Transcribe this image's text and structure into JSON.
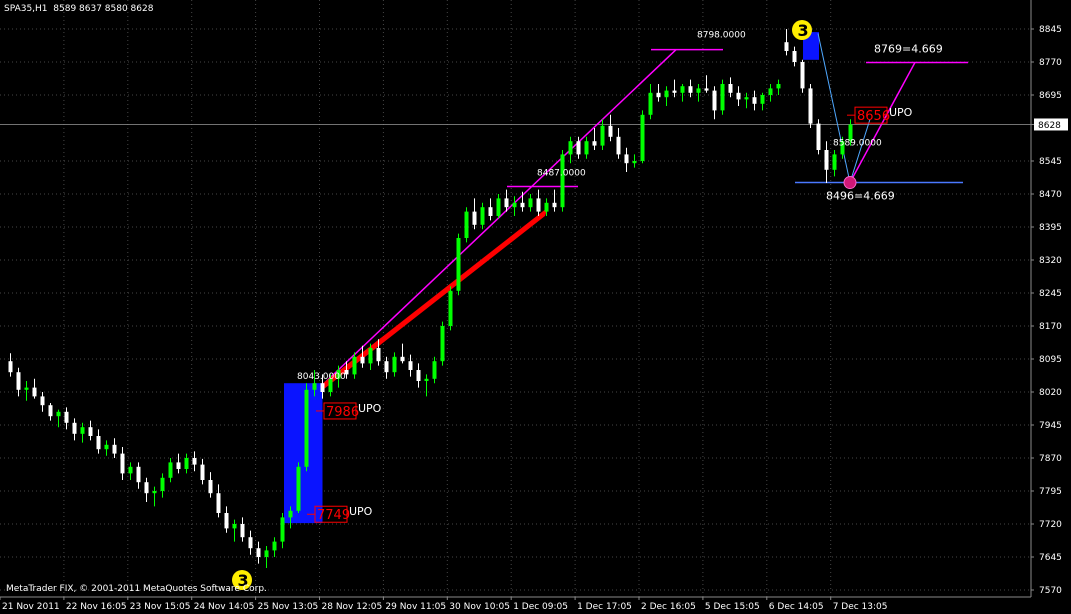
{
  "header": {
    "symbol": "SPA35,H1",
    "ohlc": "8589 8637 8580 8628"
  },
  "footer": {
    "copyright": "MetaTrader FIX, © 2001-2011 MetaQuotes Software Corp."
  },
  "colors": {
    "background": "#000000",
    "grid": "#464646",
    "bull": "#00ff00",
    "bear": "#ffffff",
    "trend_magenta": "#ff00ff",
    "trend_red": "#ff0000",
    "blue_box": "#0a14ff",
    "support_blue": "#4a78ff",
    "badge_yellow": "#ffee00",
    "label_red": "#ff0000"
  },
  "chart_data": {
    "type": "candlestick",
    "title": "SPA35,H1",
    "ylim": [
      7580,
      8880
    ],
    "y_ticks": [
      8845,
      8770,
      8695,
      8628,
      8545,
      8470,
      8395,
      8320,
      8245,
      8170,
      8095,
      8020,
      7945,
      7870,
      7795,
      7720,
      7645,
      7570
    ],
    "current_price": 8628,
    "x_ticks": [
      "21 Nov 2011",
      "22 Nov 16:05",
      "23 Nov 15:05",
      "24 Nov 14:05",
      "25 Nov 13:05",
      "28 Nov 12:05",
      "29 Nov 11:05",
      "30 Nov 10:05",
      "1 Dec 09:05",
      "1 Dec 17:05",
      "2 Dec 16:05",
      "5 Dec 15:05",
      "6 Dec 14:05",
      "7 Dec 13:05"
    ],
    "annotations": [
      {
        "text": "8043.0000",
        "price": 8043
      },
      {
        "text": "8487.0000",
        "price": 8487
      },
      {
        "text": "8798.0000",
        "price": 8798
      },
      {
        "text": "8769=4.669",
        "price": 8769
      },
      {
        "text": "8496=4.669",
        "price": 8496
      },
      {
        "text": "8589.0000",
        "price": 8589
      },
      {
        "text": "7986",
        "tag": "UPO",
        "price": 7986
      },
      {
        "text": "7749",
        "tag": "UPO",
        "price": 7749
      },
      {
        "text": "8656",
        "tag": "UPO",
        "price": 8656
      },
      {
        "text": "3",
        "kind": "badge",
        "price": 7610
      },
      {
        "text": "3",
        "kind": "badge",
        "price": 8850
      }
    ],
    "series": [
      {
        "values": [
          [
            8090,
            8108,
            8055,
            8065
          ],
          [
            8065,
            8075,
            8010,
            8025
          ],
          [
            8025,
            8045,
            8000,
            8030
          ],
          [
            8030,
            8050,
            8005,
            8010
          ],
          [
            8010,
            8020,
            7975,
            7990
          ],
          [
            7990,
            7995,
            7955,
            7965
          ],
          [
            7965,
            7980,
            7940,
            7975
          ],
          [
            7975,
            7985,
            7935,
            7950
          ],
          [
            7950,
            7960,
            7910,
            7925
          ],
          [
            7925,
            7950,
            7905,
            7940
          ],
          [
            7940,
            7955,
            7910,
            7920
          ],
          [
            7920,
            7935,
            7880,
            7890
          ],
          [
            7890,
            7910,
            7875,
            7900
          ],
          [
            7900,
            7915,
            7870,
            7880
          ],
          [
            7880,
            7895,
            7820,
            7835
          ],
          [
            7835,
            7860,
            7820,
            7850
          ],
          [
            7850,
            7860,
            7800,
            7815
          ],
          [
            7815,
            7825,
            7770,
            7790
          ],
          [
            7790,
            7805,
            7760,
            7795
          ],
          [
            7795,
            7835,
            7780,
            7825
          ],
          [
            7825,
            7870,
            7815,
            7860
          ],
          [
            7860,
            7880,
            7835,
            7845
          ],
          [
            7845,
            7880,
            7835,
            7870
          ],
          [
            7870,
            7885,
            7840,
            7855
          ],
          [
            7855,
            7868,
            7810,
            7820
          ],
          [
            7820,
            7838,
            7780,
            7790
          ],
          [
            7790,
            7810,
            7735,
            7745
          ],
          [
            7745,
            7760,
            7700,
            7710
          ],
          [
            7710,
            7730,
            7680,
            7720
          ],
          [
            7720,
            7735,
            7680,
            7690
          ],
          [
            7690,
            7705,
            7650,
            7665
          ],
          [
            7665,
            7680,
            7630,
            7645
          ],
          [
            7645,
            7670,
            7620,
            7660
          ],
          [
            7660,
            7690,
            7645,
            7680
          ],
          [
            7680,
            7745,
            7665,
            7735
          ],
          [
            7735,
            7760,
            7710,
            7750
          ],
          [
            7750,
            7860,
            7745,
            7850
          ],
          [
            7850,
            8040,
            7840,
            8025
          ],
          [
            8025,
            8070,
            8010,
            8040
          ],
          [
            8040,
            8060,
            8005,
            8020
          ],
          [
            8020,
            8060,
            8010,
            8050
          ],
          [
            8050,
            8080,
            8030,
            8070
          ],
          [
            8070,
            8090,
            8050,
            8060
          ],
          [
            8060,
            8110,
            8050,
            8100
          ],
          [
            8100,
            8125,
            8075,
            8085
          ],
          [
            8085,
            8130,
            8070,
            8120
          ],
          [
            8120,
            8140,
            8080,
            8090
          ],
          [
            8090,
            8100,
            8050,
            8065
          ],
          [
            8065,
            8110,
            8055,
            8100
          ],
          [
            8100,
            8130,
            8085,
            8090
          ],
          [
            8090,
            8105,
            8055,
            8070
          ],
          [
            8070,
            8085,
            8030,
            8045
          ],
          [
            8045,
            8060,
            8010,
            8050
          ],
          [
            8050,
            8100,
            8040,
            8090
          ],
          [
            8090,
            8180,
            8080,
            8170
          ],
          [
            8170,
            8260,
            8160,
            8250
          ],
          [
            8250,
            8380,
            8240,
            8370
          ],
          [
            8370,
            8440,
            8360,
            8430
          ],
          [
            8430,
            8460,
            8390,
            8400
          ],
          [
            8400,
            8450,
            8390,
            8440
          ],
          [
            8440,
            8460,
            8410,
            8420
          ],
          [
            8420,
            8470,
            8415,
            8460
          ],
          [
            8460,
            8480,
            8430,
            8440
          ],
          [
            8440,
            8465,
            8420,
            8450
          ],
          [
            8450,
            8475,
            8430,
            8440
          ],
          [
            8440,
            8470,
            8430,
            8460
          ],
          [
            8460,
            8480,
            8420,
            8430
          ],
          [
            8430,
            8460,
            8420,
            8450
          ],
          [
            8450,
            8480,
            8430,
            8440
          ],
          [
            8440,
            8570,
            8430,
            8560
          ],
          [
            8560,
            8600,
            8540,
            8590
          ],
          [
            8590,
            8600,
            8550,
            8560
          ],
          [
            8560,
            8600,
            8550,
            8590
          ],
          [
            8590,
            8620,
            8570,
            8580
          ],
          [
            8580,
            8640,
            8570,
            8625
          ],
          [
            8625,
            8650,
            8590,
            8600
          ],
          [
            8600,
            8620,
            8550,
            8560
          ],
          [
            8560,
            8575,
            8520,
            8540
          ],
          [
            8540,
            8560,
            8530,
            8545
          ],
          [
            8545,
            8660,
            8540,
            8650
          ],
          [
            8650,
            8720,
            8640,
            8700
          ],
          [
            8700,
            8720,
            8680,
            8690
          ],
          [
            8690,
            8715,
            8670,
            8705
          ],
          [
            8705,
            8730,
            8690,
            8700
          ],
          [
            8700,
            8720,
            8680,
            8715
          ],
          [
            8715,
            8730,
            8690,
            8700
          ],
          [
            8700,
            8720,
            8680,
            8710
          ],
          [
            8710,
            8740,
            8700,
            8705
          ],
          [
            8705,
            8715,
            8640,
            8660
          ],
          [
            8660,
            8730,
            8650,
            8720
          ],
          [
            8720,
            8735,
            8690,
            8700
          ],
          [
            8700,
            8715,
            8670,
            8685
          ],
          [
            8685,
            8700,
            8665,
            8690
          ],
          [
            8690,
            8705,
            8660,
            8675
          ],
          [
            8675,
            8700,
            8660,
            8695
          ],
          [
            8695,
            8720,
            8680,
            8710
          ],
          [
            8710,
            8730,
            8695,
            8720
          ],
          [
            8815,
            8845,
            8785,
            8795
          ],
          [
            8795,
            8805,
            8760,
            8770
          ],
          [
            8770,
            8775,
            8700,
            8710
          ],
          [
            8710,
            8720,
            8620,
            8630
          ],
          [
            8630,
            8640,
            8560,
            8570
          ],
          [
            8570,
            8590,
            8495,
            8525
          ],
          [
            8525,
            8570,
            8510,
            8560
          ],
          [
            8560,
            8600,
            8550,
            8590
          ],
          [
            8590,
            8640,
            8580,
            8628
          ]
        ]
      }
    ]
  }
}
